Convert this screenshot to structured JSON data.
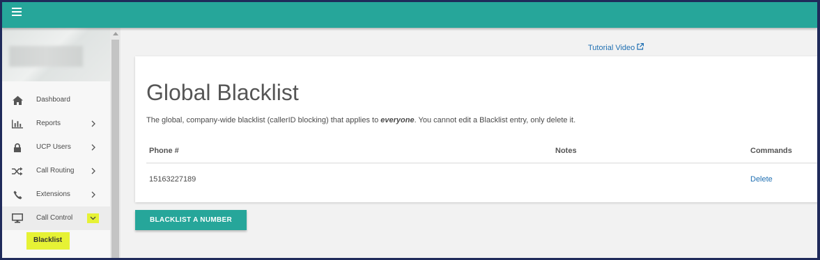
{
  "topbar": {
    "menu_icon": "hamburger-icon"
  },
  "sidebar": {
    "items": [
      {
        "label": "Dashboard",
        "icon": "home-icon",
        "has_chevron": false
      },
      {
        "label": "Reports",
        "icon": "bar-chart-icon",
        "has_chevron": true
      },
      {
        "label": "UCP Users",
        "icon": "lock-icon",
        "has_chevron": true
      },
      {
        "label": "Call Routing",
        "icon": "shuffle-icon",
        "has_chevron": true
      },
      {
        "label": "Extensions",
        "icon": "phone-icon",
        "has_chevron": true
      },
      {
        "label": "Call Control",
        "icon": "monitor-icon",
        "has_chevron": true,
        "expanded": true
      }
    ],
    "sub_items": [
      {
        "label": "Blacklist",
        "highlighted": true
      }
    ]
  },
  "main": {
    "tutorial_link": "Tutorial Video",
    "title": "Global Blacklist",
    "description_before": "The global, company-wide blacklist (callerID blocking) that applies to ",
    "description_emphasis": "everyone",
    "description_after": ". You cannot edit a Blacklist entry, only delete it.",
    "table": {
      "columns": [
        "Phone #",
        "Notes",
        "Commands"
      ],
      "rows": [
        {
          "phone": "15163227189",
          "notes": "",
          "command": "Delete"
        }
      ]
    },
    "add_button": "BLACKLIST A NUMBER"
  },
  "colors": {
    "accent": "#26a69a",
    "link": "#1f6fb2",
    "highlight": "#e6f235"
  }
}
